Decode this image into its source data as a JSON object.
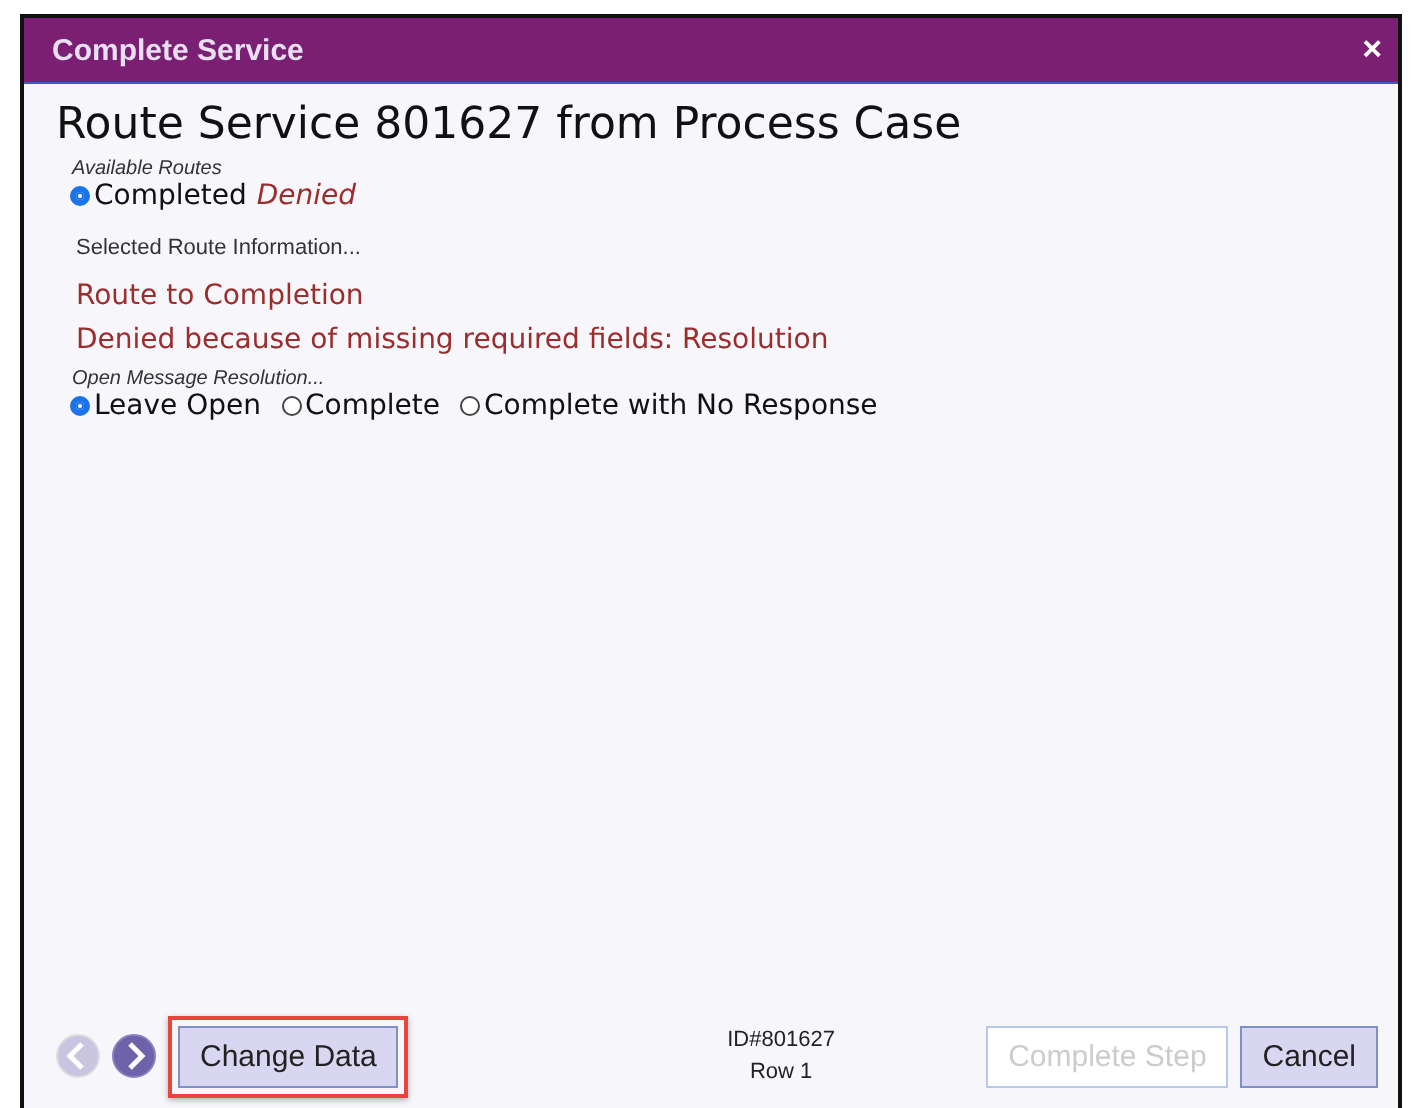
{
  "window": {
    "title": "Complete Service",
    "close": "×"
  },
  "heading": "Route Service 801627 from Process Case",
  "routes": {
    "label": "Available Routes",
    "options": [
      {
        "label": "Completed",
        "note": "Denied",
        "selected": true
      }
    ]
  },
  "info_label": "Selected Route Information...",
  "messages": [
    "Route to Completion",
    "Denied because of missing required fields: Resolution"
  ],
  "resolution": {
    "label": "Open Message Resolution...",
    "options": [
      {
        "label": "Leave Open",
        "selected": true
      },
      {
        "label": "Complete",
        "selected": false
      },
      {
        "label": "Complete with No Response",
        "selected": false
      }
    ]
  },
  "footer": {
    "prev": {
      "disabled": true
    },
    "next": {
      "disabled": false
    },
    "change_button": {
      "label": "Change Data",
      "highlighted": true
    },
    "id_text": "ID#801627",
    "row_text": "Row 1",
    "buttons": [
      {
        "label": "Complete Step",
        "disabled": true
      },
      {
        "label": "Cancel",
        "disabled": false
      }
    ]
  }
}
